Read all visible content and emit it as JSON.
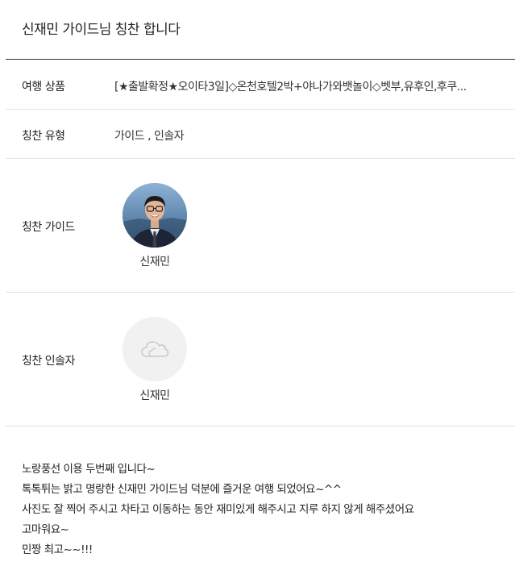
{
  "page": {
    "title": "신재민 가이드님 칭찬 합니다"
  },
  "fields": {
    "product_label": "여행 상품",
    "product_value": "[★출발확정★오이타3일]◇온천호텔2박+야나가와뱃놀이◇벳부,유후인,후쿠...",
    "type_label": "칭찬 유형",
    "type_value": "가이드 , 인솔자",
    "guide_label": "칭찬 가이드",
    "guide_name": "신재민",
    "leader_label": "칭찬 인솔자",
    "leader_name": "신재민"
  },
  "icons": {
    "guide_avatar": "guide-photo",
    "leader_avatar": "cloud-placeholder-icon"
  },
  "review": {
    "lines": [
      "노랑풍선 이용 두번째 입니다~",
      "톡톡튀는 밝고 명랑한 신재민 가이드님 덕분에 즐거운 여행 되었어요~^^",
      "사진도 잘 찍어 주시고 차타고 이동하는 동안 재미있게 해주시고 지루 하지 않게 해주셨어요",
      "고마워요~",
      "민짱 최고~~!!!"
    ]
  }
}
